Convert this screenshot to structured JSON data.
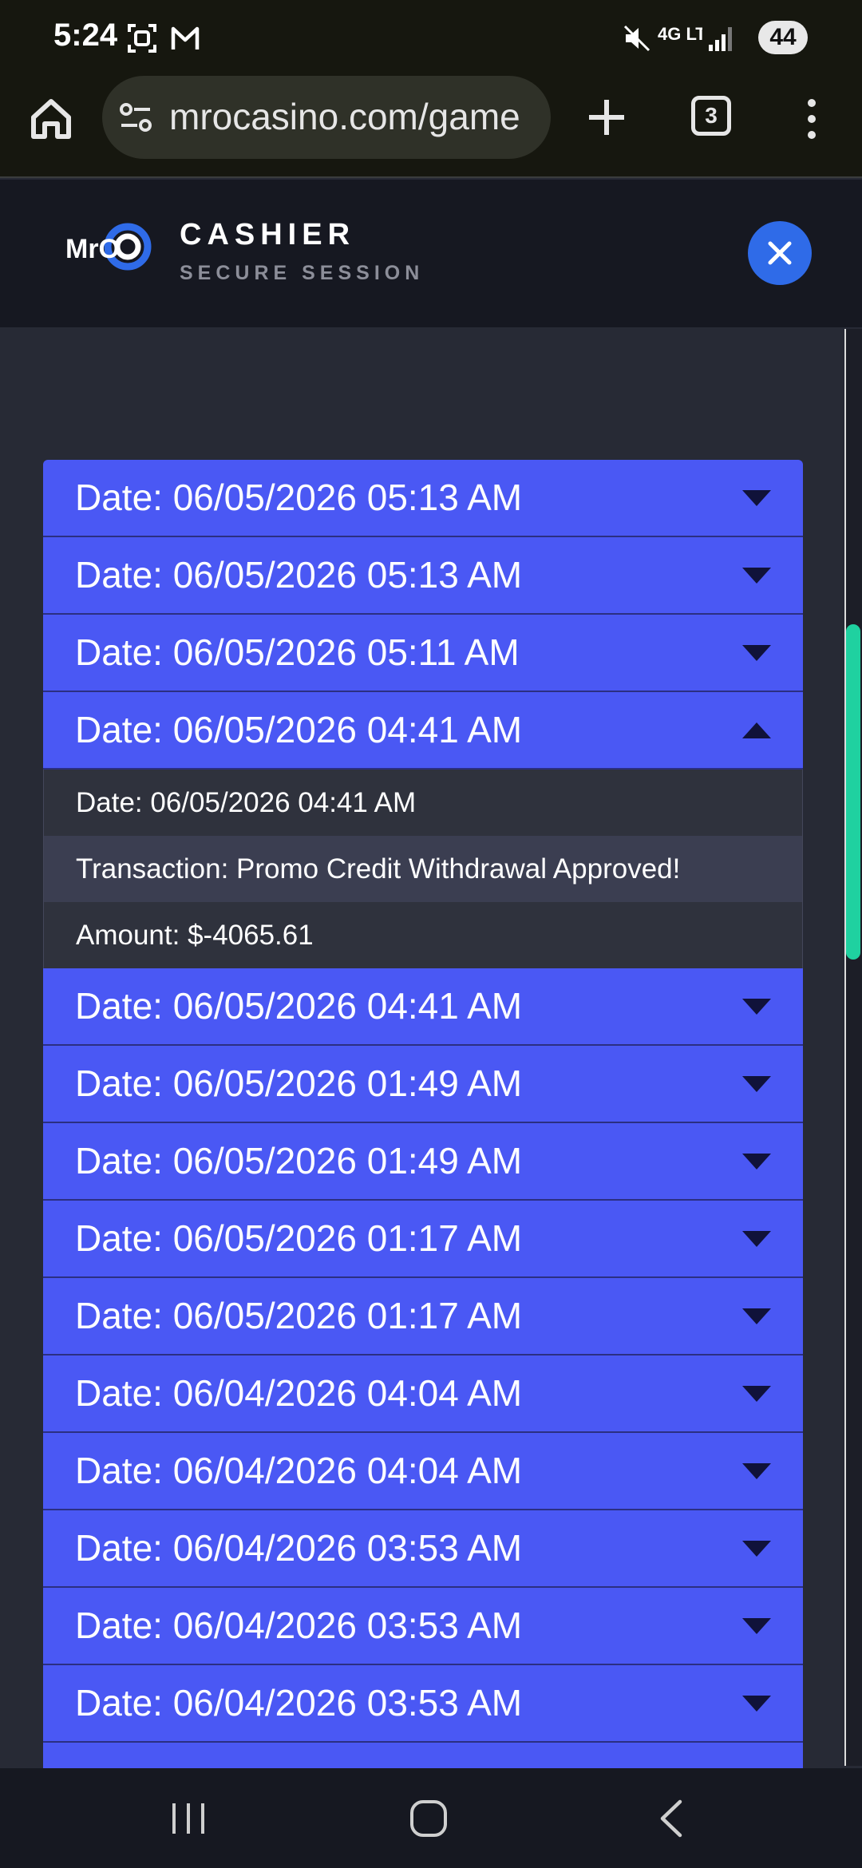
{
  "status": {
    "time": "5:24",
    "battery": "44",
    "network": "4G LTE"
  },
  "browser": {
    "url": "mrocasino.com/game",
    "tab_count": "3"
  },
  "header": {
    "logo_text": "MrO",
    "title": "CASHIER",
    "subtitle": "SECURE SESSION"
  },
  "transactions": {
    "rows_before": [
      {
        "label": "Date: 06/05/2026 05:13 AM"
      },
      {
        "label": "Date: 06/05/2026 05:13 AM"
      },
      {
        "label": "Date: 06/05/2026 05:11 AM"
      }
    ],
    "expanded": {
      "label": "Date: 06/05/2026 04:41 AM",
      "detail_date": "Date: 06/05/2026 04:41 AM",
      "detail_transaction": "Transaction: Promo Credit Withdrawal Approved!",
      "detail_amount": "Amount: $-4065.61"
    },
    "rows_after": [
      {
        "label": "Date: 06/05/2026 04:41 AM"
      },
      {
        "label": "Date: 06/05/2026 01:49 AM"
      },
      {
        "label": "Date: 06/05/2026 01:49 AM"
      },
      {
        "label": "Date: 06/05/2026 01:17 AM"
      },
      {
        "label": "Date: 06/05/2026 01:17 AM"
      },
      {
        "label": "Date: 06/04/2026 04:04 AM"
      },
      {
        "label": "Date: 06/04/2026 04:04 AM"
      },
      {
        "label": "Date: 06/04/2026 03:53 AM"
      },
      {
        "label": "Date: 06/04/2026 03:53 AM"
      },
      {
        "label": "Date: 06/04/2026 03:53 AM"
      }
    ]
  },
  "colors": {
    "row_bg": "#4a58f4",
    "accent_close": "#2f6be8",
    "scroll_thumb": "#1fd1a0"
  }
}
